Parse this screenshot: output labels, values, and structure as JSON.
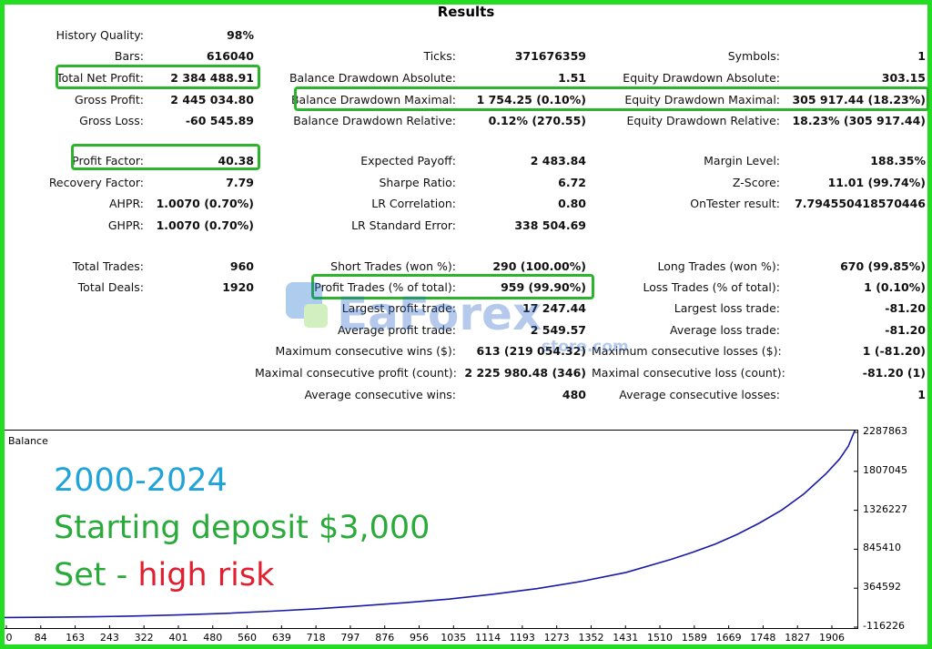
{
  "title": "Results",
  "colors": {
    "frame": "#22dd22",
    "highlight": "#2cb52c",
    "line": "#1a1aa8",
    "blue_text": "#1fa3d8",
    "green_text": "#2aaa3a",
    "red_text": "#e02030"
  },
  "stats": {
    "history_quality": {
      "label": "History Quality:",
      "value": "98%"
    },
    "bars": {
      "label": "Bars:",
      "value": "616040"
    },
    "ticks": {
      "label": "Ticks:",
      "value": "371676359"
    },
    "symbols": {
      "label": "Symbols:",
      "value": "1"
    },
    "total_net_profit": {
      "label": "Total Net Profit:",
      "value": "2 384 488.91"
    },
    "balance_dd_abs": {
      "label": "Balance Drawdown Absolute:",
      "value": "1.51"
    },
    "equity_dd_abs": {
      "label": "Equity Drawdown Absolute:",
      "value": "303.15"
    },
    "gross_profit": {
      "label": "Gross Profit:",
      "value": "2 445 034.80"
    },
    "balance_dd_max": {
      "label": "Balance Drawdown Maximal:",
      "value": "1 754.25 (0.10%)"
    },
    "equity_dd_max": {
      "label": "Equity Drawdown Maximal:",
      "value": "305 917.44 (18.23%)"
    },
    "gross_loss": {
      "label": "Gross Loss:",
      "value": "-60 545.89"
    },
    "balance_dd_rel": {
      "label": "Balance Drawdown Relative:",
      "value": "0.12% (270.55)"
    },
    "equity_dd_rel": {
      "label": "Equity Drawdown Relative:",
      "value": "18.23% (305 917.44)"
    },
    "profit_factor": {
      "label": "Profit Factor:",
      "value": "40.38"
    },
    "expected_payoff": {
      "label": "Expected Payoff:",
      "value": "2 483.84"
    },
    "margin_level": {
      "label": "Margin Level:",
      "value": "188.35%"
    },
    "recovery_factor": {
      "label": "Recovery Factor:",
      "value": "7.79"
    },
    "sharpe_ratio": {
      "label": "Sharpe Ratio:",
      "value": "6.72"
    },
    "z_score": {
      "label": "Z-Score:",
      "value": "11.01 (99.74%)"
    },
    "ahpr": {
      "label": "AHPR:",
      "value": "1.0070 (0.70%)"
    },
    "lr_correlation": {
      "label": "LR Correlation:",
      "value": "0.80"
    },
    "ontester_result": {
      "label": "OnTester result:",
      "value": "7.794550418570446"
    },
    "ghpr": {
      "label": "GHPR:",
      "value": "1.0070 (0.70%)"
    },
    "lr_standard_error": {
      "label": "LR Standard Error:",
      "value": "338 504.69"
    },
    "total_trades": {
      "label": "Total Trades:",
      "value": "960"
    },
    "short_trades": {
      "label": "Short Trades (won %):",
      "value": "290 (100.00%)"
    },
    "long_trades": {
      "label": "Long Trades (won %):",
      "value": "670 (99.85%)"
    },
    "total_deals": {
      "label": "Total Deals:",
      "value": "1920"
    },
    "profit_trades": {
      "label": "Profit Trades (% of total):",
      "value": "959 (99.90%)"
    },
    "loss_trades": {
      "label": "Loss Trades (% of total):",
      "value": "1 (0.10%)"
    },
    "largest_profit_trade": {
      "label": "Largest profit trade:",
      "value": "17 247.44"
    },
    "largest_loss_trade": {
      "label": "Largest loss trade:",
      "value": "-81.20"
    },
    "average_profit_trade": {
      "label": "Average profit trade:",
      "value": "2 549.57"
    },
    "average_loss_trade": {
      "label": "Average loss trade:",
      "value": "-81.20"
    },
    "max_consec_wins": {
      "label": "Maximum consecutive wins ($):",
      "value": "613 (219 054.32)"
    },
    "max_consec_losses": {
      "label": "Maximum consecutive losses ($):",
      "value": "1 (-81.20)"
    },
    "maximal_consec_profit": {
      "label": "Maximal consecutive profit (count):",
      "value": "2 225 980.48 (346)"
    },
    "maximal_consec_loss": {
      "label": "Maximal consecutive loss (count):",
      "value": "-81.20 (1)"
    },
    "avg_consec_wins": {
      "label": "Average consecutive wins:",
      "value": "480"
    },
    "avg_consec_losses": {
      "label": "Average consecutive losses:",
      "value": "1"
    }
  },
  "watermark": {
    "brand_part1": "EaForex",
    "brand_part2": "store.com"
  },
  "overlay": {
    "line1": "2000-2024",
    "line2": "Starting deposit $3,000",
    "line3_a": "Set - ",
    "line3_b": "high risk"
  },
  "chart_data": {
    "type": "line",
    "title": "Balance",
    "x_ticks": [
      "0",
      "84",
      "163",
      "243",
      "322",
      "401",
      "480",
      "560",
      "639",
      "718",
      "797",
      "876",
      "956",
      "1035",
      "1114",
      "1193",
      "1273",
      "1352",
      "1431",
      "1510",
      "1589",
      "1669",
      "1748",
      "1827",
      "1906"
    ],
    "y_ticks": [
      "2287863",
      "1807045",
      "1326227",
      "845410",
      "364592",
      "-116226"
    ],
    "xlim": [
      0,
      1920
    ],
    "ylim": [
      -116226,
      2287863
    ],
    "series": [
      {
        "x": [
          0,
          100,
          200,
          300,
          400,
          500,
          600,
          700,
          800,
          900,
          1000,
          1100,
          1200,
          1300,
          1400,
          1500,
          1550,
          1600,
          1650,
          1700,
          1750,
          1800,
          1850,
          1880,
          1900,
          1920
        ],
        "y": [
          3000,
          6000,
          12000,
          22000,
          36000,
          55000,
          80000,
          110000,
          145000,
          185000,
          230000,
          290000,
          360000,
          450000,
          560000,
          720000,
          810000,
          910000,
          1030000,
          1170000,
          1330000,
          1530000,
          1780000,
          1960000,
          2120000,
          2387488
        ]
      }
    ]
  }
}
